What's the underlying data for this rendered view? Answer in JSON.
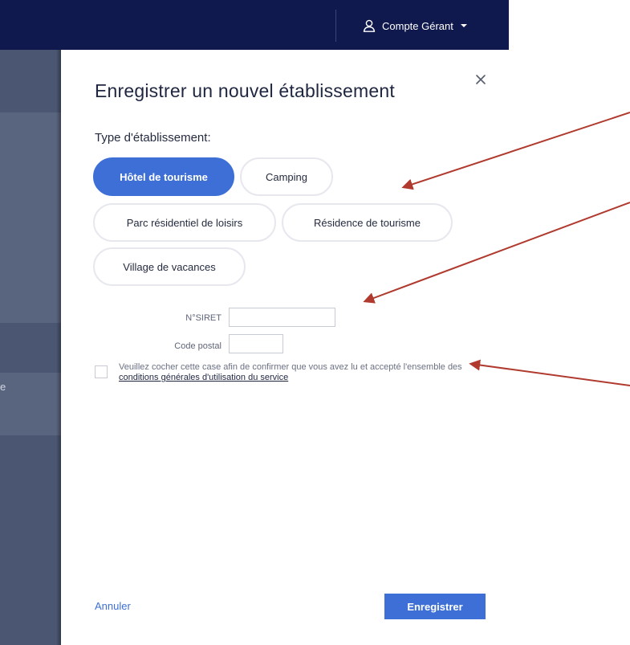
{
  "header": {
    "account_label": "Compte Gérant",
    "account_icon": "user-icon",
    "caret_icon": "caret-down-icon",
    "background": "#10194d"
  },
  "sidebar": {
    "fragment_text": "e"
  },
  "modal": {
    "title": "Enregistrer un nouvel établissement",
    "close_icon": "close-icon",
    "type_label": "Type d'établissement:",
    "types": [
      {
        "label": "Hôtel de tourisme",
        "selected": true
      },
      {
        "label": "Camping",
        "selected": false
      },
      {
        "label": "Parc résidentiel de loisirs",
        "selected": false
      },
      {
        "label": "Résidence de tourisme",
        "selected": false
      },
      {
        "label": "Village de vacances",
        "selected": false
      }
    ],
    "fields": {
      "siret_label": "N°SIRET",
      "siret_value": "",
      "postal_label": "Code postal",
      "postal_value": ""
    },
    "consent": {
      "checked": false,
      "text": "Veuillez cocher cette case afin de confirmer que vous avez lu et accepté l'ensemble des ",
      "link": "conditions générales d'utilisation du service"
    },
    "cancel_label": "Annuler",
    "save_label": "Enregistrer"
  },
  "colors": {
    "accent": "#3d6fd6",
    "annotation_arrow": "#b03a2e",
    "overlay": "#4b5672"
  }
}
